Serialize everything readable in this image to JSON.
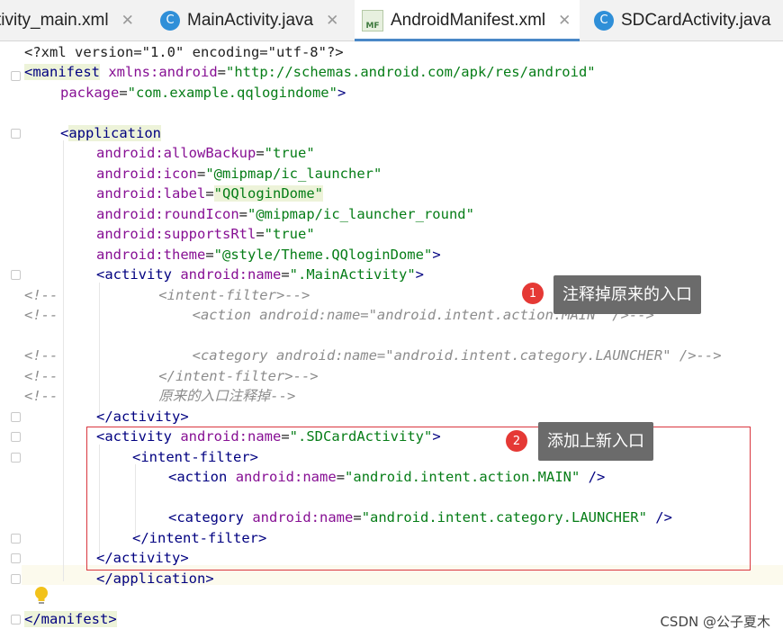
{
  "tabs": [
    {
      "label": "tivity_main.xml",
      "icon": "xml-file-icon",
      "active": false
    },
    {
      "label": "MainActivity.java",
      "icon": "class-c-icon",
      "active": false
    },
    {
      "label": "AndroidManifest.xml",
      "icon": "manifest-mf-icon",
      "active": true
    },
    {
      "label": "SDCardActivity.java",
      "icon": "class-c-icon",
      "active": false
    }
  ],
  "close_glyph": "✕",
  "mf_label": "MF",
  "class_glyph": "C",
  "code": {
    "l1": {
      "a": "<?xml version=\"1.0\" encoding=\"utf-8\"?>"
    },
    "l2": {
      "tag": "manifest",
      "attr": "xmlns:android",
      "eq": "=",
      "val": "\"http://schemas.android.com/apk/res/android\""
    },
    "l3": {
      "attr": "package",
      "eq": "=",
      "val": "\"com.example.qqlogindome\"",
      "close": ">"
    },
    "l5": {
      "tag": "application"
    },
    "l6": {
      "ns": "android",
      "attr": ":allowBackup",
      "eq": "=",
      "val": "\"true\""
    },
    "l7": {
      "ns": "android",
      "attr": ":icon",
      "eq": "=",
      "val": "\"@mipmap/ic_launcher\""
    },
    "l8": {
      "ns": "android",
      "attr": ":label",
      "eq": "=",
      "val": "\"QQloginDome\""
    },
    "l9": {
      "ns": "android",
      "attr": ":roundIcon",
      "eq": "=",
      "val": "\"@mipmap/ic_launcher_round\""
    },
    "l10": {
      "ns": "android",
      "attr": ":supportsRtl",
      "eq": "=",
      "val": "\"true\""
    },
    "l11": {
      "ns": "android",
      "attr": ":theme",
      "eq": "=",
      "val": "\"@style/Theme.QQloginDome\"",
      "close": ">"
    },
    "l12": {
      "tag": "activity",
      "attr": "android:name",
      "eq": "=",
      "val": "\".MainActivity\"",
      "close": ">"
    },
    "l13": {
      "text": "<!--            <intent-filter>-->"
    },
    "l14": {
      "text": "<!--                <action android:name=\"android.intent.action.MAIN\" />-->"
    },
    "l16": {
      "text": "<!--                <category android:name=\"android.intent.category.LAUNCHER\" />-->"
    },
    "l17": {
      "text": "<!--            </intent-filter>-->"
    },
    "l18": {
      "text": "<!--            原来的入口注释掉-->"
    },
    "l19": {
      "text": "</activity>"
    },
    "l20": {
      "tag": "activity",
      "attr": "android:name",
      "eq": "=",
      "val": "\".SDCardActivity\"",
      "close": ">"
    },
    "l21": {
      "text": "<intent-filter>"
    },
    "l22": {
      "tag": "action",
      "ns": "android",
      "attr": ":name",
      "eq": "=",
      "val": "\"android.intent.action.MAIN\"",
      "close": " />"
    },
    "l24": {
      "tag": "category",
      "ns": "android",
      "attr": ":name",
      "eq": "=",
      "val": "\"android.intent.category.LAUNCHER\"",
      "close": " />"
    },
    "l25": {
      "text": "</intent-filter>"
    },
    "l26": {
      "text": "</activity>"
    },
    "l27": {
      "text": "</application>"
    },
    "l29": {
      "text": "</manifest>"
    }
  },
  "annotations": {
    "one": {
      "num": "1",
      "text": "注释掉原来的入口"
    },
    "two": {
      "num": "2",
      "text": "添加上新入口"
    }
  },
  "watermark": "CSDN @公子夏木",
  "colors": {
    "tag": "#000080",
    "attr": "#871094",
    "value": "#067d17",
    "comment": "#8c8c8c",
    "annotation_box": "#d9363e",
    "badge": "#e53935",
    "callout": "#6b6b6b"
  }
}
